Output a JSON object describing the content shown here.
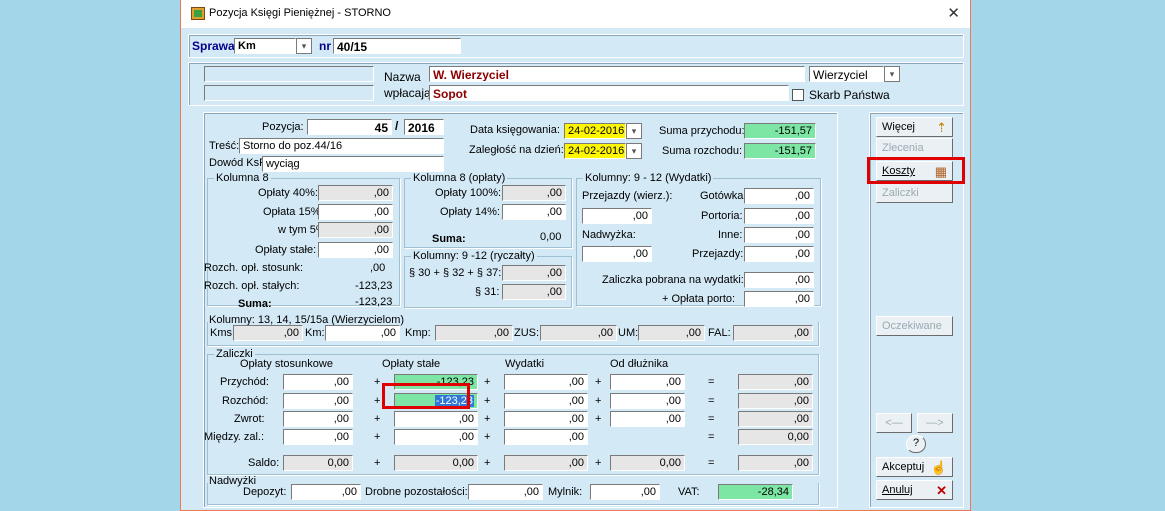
{
  "window": {
    "title": "Pozycja Księgi Pieniężnej - STORNO",
    "close": "✕"
  },
  "sprawa": {
    "label": "Sprawa",
    "value": "Km",
    "nr_label": "nr",
    "nr": "40/15"
  },
  "payer": {
    "nazwa_label": "Nazwa",
    "wplac_label": "wpłacającego:",
    "name": "W. Wierzyciel",
    "city": "Sopot",
    "type": "Wierzyciel",
    "skarb_label": "Skarb Państwa"
  },
  "pos": {
    "pozycja_label": "Pozycja:",
    "number": "45",
    "slash": "/",
    "year": "2016",
    "tresc_label": "Treść:",
    "tresc": "Storno do poz.44/16",
    "dowod_label": "Dowód KsP:",
    "dowod": "wyciąg",
    "data_label": "Data księgowania:",
    "data": "24-02-2016",
    "zaleg_label": "Zaległość na dzień:",
    "zaleg": "24-02-2016",
    "sum_przych_label": "Suma przychodu:",
    "sum_przych": "-151,57",
    "sum_rozch_label": "Suma rozchodu:",
    "sum_rozch": "-151,57"
  },
  "k8": {
    "title": "Kolumna 8",
    "labels": [
      "Opłaty 40%:",
      "Opłata 15%",
      "w tym 5%:",
      "Opłaty stałe:",
      "Rozch. opł. stosunk:",
      "Rozch. opł. stałych:",
      "Suma:"
    ],
    "values": [
      ",00",
      ",00",
      ",00",
      ",00",
      ",00",
      "-123,23",
      "-123,23"
    ]
  },
  "k8o": {
    "title": "Kolumna 8 (opłaty)",
    "labels": [
      "Opłaty 100%:",
      "Opłaty 14%:",
      "Suma:"
    ],
    "values": [
      ",00",
      ",00",
      "0,00"
    ]
  },
  "k912r": {
    "title": "Kolumny: 9 -12 (ryczałty)",
    "labels": [
      "§ 30 + § 32 + § 37:",
      "§ 31:"
    ],
    "values": [
      ",00",
      ",00"
    ]
  },
  "k912w": {
    "title": "Kolumny: 9 - 12   (Wydatki)",
    "przejazdy_w": "Przejazdy (wierz.):",
    "gotowka": "Gotówka:",
    "przejazdy_w_val": ",00",
    "gotowka_val": ",00",
    "portoria": "Portoria:",
    "portoria_val": ",00",
    "nadwyzka": "Nadwyżka:",
    "nadwyzka_val": ",00",
    "inne": "Inne:",
    "inne_val": ",00",
    "przejazdy": "Przejazdy:",
    "przejazdy_val": ",00",
    "zaliczka": "Zaliczka pobrana na wydatki:",
    "zaliczka_val": ",00",
    "oplata": "+  Opłata porto:",
    "oplata_val": ",00"
  },
  "kms": {
    "title": "Kolumny: 13, 14, 15/15a   (Wierzycielom)",
    "items": [
      {
        "label": "Kms:",
        "value": ",00"
      },
      {
        "label": "Km:",
        "value": ",00"
      },
      {
        "label": "Kmp:",
        "value": ",00"
      },
      {
        "label": "ZUS:",
        "value": ",00"
      },
      {
        "label": "UM:",
        "value": ",00"
      },
      {
        "label": "FAL:",
        "value": ",00"
      }
    ]
  },
  "zal": {
    "title": "Zaliczki",
    "headers": [
      "Opłaty stosunkowe",
      "Opłaty stałe",
      "Wydatki",
      "Od dłużnika"
    ],
    "rows": [
      {
        "label": "Przychód:",
        "a": ",00",
        "b": "-123,23",
        "c": ",00",
        "d": ",00",
        "e": ",00"
      },
      {
        "label": "Rozchód:",
        "a": ",00",
        "b": "-123,23",
        "c": ",00",
        "d": ",00",
        "e": ",00"
      },
      {
        "label": "Zwrot:",
        "a": ",00",
        "b": ",00",
        "c": ",00",
        "d": ",00",
        "e": ",00"
      },
      {
        "label": "Międzу. zal.:",
        "a": ",00",
        "b": ",00",
        "c": ",00",
        "d": "",
        "e": "0,00"
      },
      {
        "label": "Saldo:",
        "a": "0,00",
        "b": "0,00",
        "c": ",00",
        "d": "0,00",
        "e": ",00"
      }
    ],
    "plus": "+",
    "eq": "="
  },
  "nad": {
    "title": "Nadwyżki",
    "depozyt_label": "Depozyt:",
    "depozyt": ",00",
    "drobne_label": "Drobne pozostałości:",
    "drobne": ",00",
    "mylnik_label": "Mylnik:",
    "mylnik": ",00",
    "vat_label": "VAT:",
    "vat": "-28,34"
  },
  "buttons": {
    "wiecej": "Więcej",
    "zlecenia": "Zlecenia",
    "koszty": "Koszty",
    "zaliczki": "Zaliczki",
    "oczekiwane": "Oczekiwane",
    "prev": "<—",
    "next": "—>",
    "help": "?",
    "akceptuj": "Akceptuj",
    "anuluj": "Anuluj"
  },
  "colors": {
    "highlight": "#e00000",
    "green_field": "#7ee6a4",
    "yellow_field": "#fff700"
  }
}
